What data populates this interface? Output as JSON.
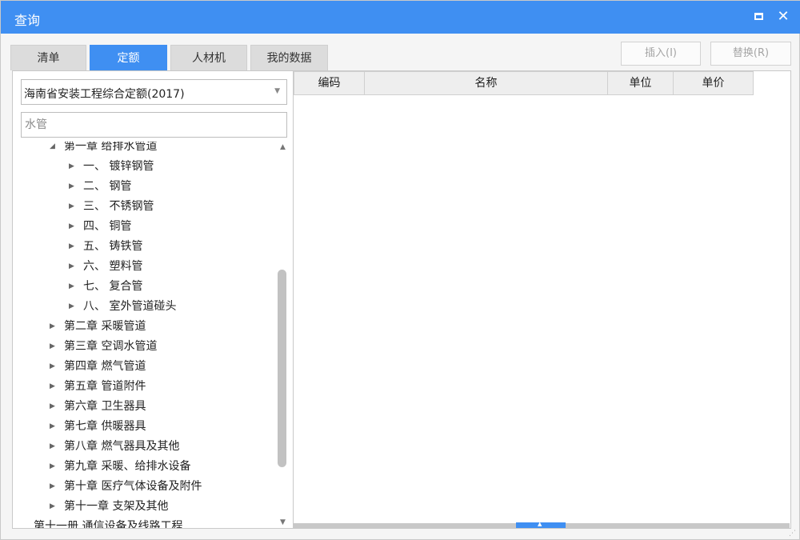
{
  "window": {
    "title": "查询"
  },
  "tabs": [
    {
      "label": "清单",
      "active": false
    },
    {
      "label": "定额",
      "active": true
    },
    {
      "label": "人材机",
      "active": false
    },
    {
      "label": "我的数据",
      "active": false
    }
  ],
  "actions": {
    "insert_label": "插入(I)",
    "replace_label": "替换(R)"
  },
  "library_select": {
    "value": "海南省安装工程综合定额(2017)"
  },
  "search": {
    "value": "水管"
  },
  "tree": [
    {
      "label": "第一章 给排水管道",
      "expanded": true,
      "level": 1
    },
    {
      "label": "一、  镀锌钢管",
      "expanded": false,
      "level": 2
    },
    {
      "label": "二、  钢管",
      "expanded": false,
      "level": 2
    },
    {
      "label": "三、  不锈钢管",
      "expanded": false,
      "level": 2
    },
    {
      "label": "四、  铜管",
      "expanded": false,
      "level": 2
    },
    {
      "label": "五、  铸铁管",
      "expanded": false,
      "level": 2
    },
    {
      "label": "六、  塑料管",
      "expanded": false,
      "level": 2
    },
    {
      "label": "七、  复合管",
      "expanded": false,
      "level": 2
    },
    {
      "label": "八、  室外管道碰头",
      "expanded": false,
      "level": 2
    },
    {
      "label": "第二章 采暖管道",
      "expanded": false,
      "level": 1
    },
    {
      "label": "第三章 空调水管道",
      "expanded": false,
      "level": 1
    },
    {
      "label": "第四章 燃气管道",
      "expanded": false,
      "level": 1
    },
    {
      "label": "第五章 管道附件",
      "expanded": false,
      "level": 1
    },
    {
      "label": "第六章 卫生器具",
      "expanded": false,
      "level": 1
    },
    {
      "label": "第七章 供暖器具",
      "expanded": false,
      "level": 1
    },
    {
      "label": "第八章 燃气器具及其他",
      "expanded": false,
      "level": 1
    },
    {
      "label": "第九章 采暖、给排水设备",
      "expanded": false,
      "level": 1
    },
    {
      "label": "第十章 医疗气体设备及附件",
      "expanded": false,
      "level": 1
    },
    {
      "label": "第十一章 支架及其他",
      "expanded": false,
      "level": 1
    },
    {
      "label": "第十一册 通信设备及线路工程",
      "expanded": false,
      "level": 0
    }
  ],
  "grid": {
    "columns": [
      "编码",
      "名称",
      "单位",
      "单价"
    ]
  },
  "icons": {
    "maximize": "maximize-icon",
    "close": "close-icon",
    "dropdown": "chevron-down-icon",
    "expanded": "triangle-down-icon",
    "collapsed": "triangle-right-icon"
  },
  "colors": {
    "accent": "#3f8ff2"
  }
}
